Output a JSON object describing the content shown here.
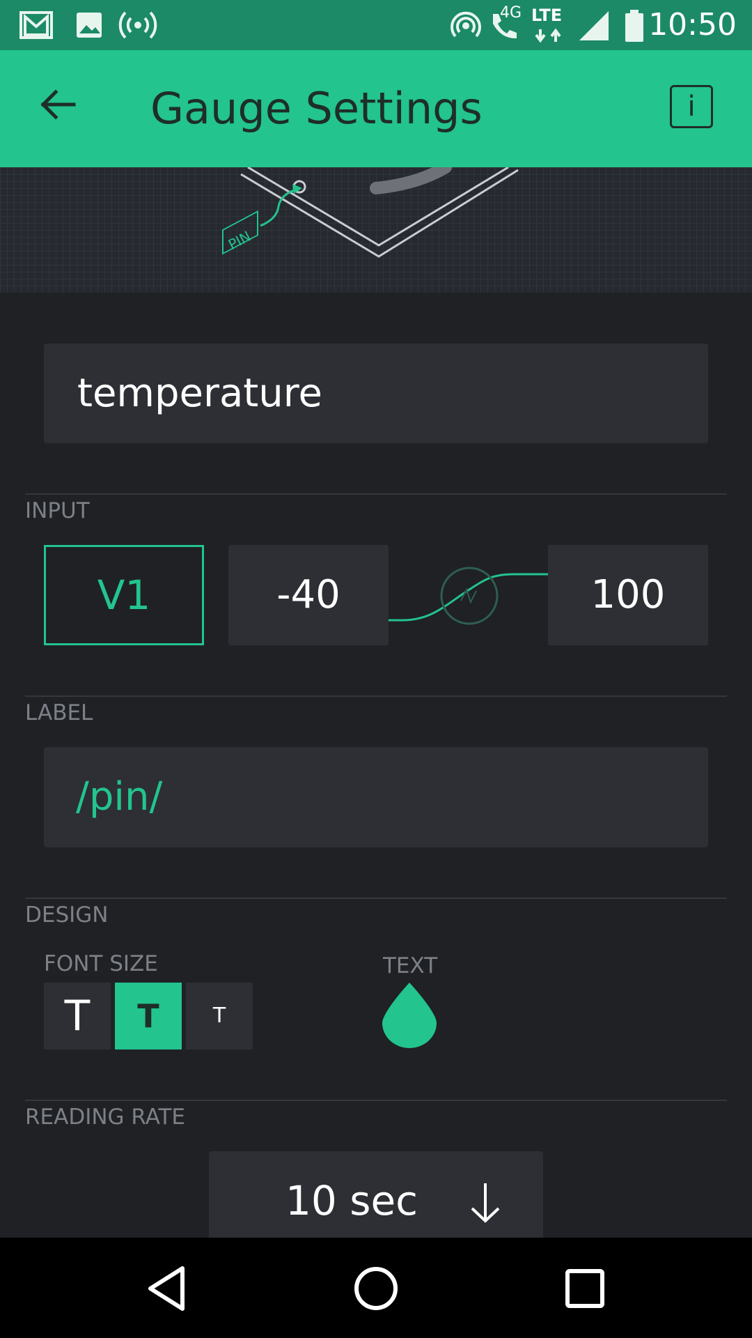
{
  "status_bar": {
    "time": "10:50",
    "network_label": "LTE",
    "network_type": "4G",
    "left_icons": [
      "gmail-icon",
      "image-icon",
      "broadcast-icon"
    ],
    "right_icons": [
      "hotspot-icon",
      "wifi-call-icon",
      "signal-icon",
      "battery-icon"
    ]
  },
  "app_bar": {
    "title": "Gauge Settings",
    "back_icon": "arrow-left-icon",
    "info_label": "i"
  },
  "preview": {
    "pin_tag": "PIN"
  },
  "name_field": {
    "value": "temperature"
  },
  "input": {
    "section_label": "INPUT",
    "pin": "V1",
    "min": "-40",
    "max": "100"
  },
  "label": {
    "section_label": "LABEL",
    "value": "/pin/"
  },
  "design": {
    "section_label": "DESIGN",
    "font_size_label": "FONT SIZE",
    "font_size_options": [
      "T",
      "T",
      "T"
    ],
    "selected_font_size_index": 1,
    "text_color_label": "TEXT",
    "text_color": "#23c48e"
  },
  "reading_rate": {
    "section_label": "READING RATE",
    "value": "10 sec"
  },
  "colors": {
    "accent": "#23c48e",
    "background": "#1f2125",
    "field": "#2d2f34",
    "status_bar": "#1c8a66"
  }
}
